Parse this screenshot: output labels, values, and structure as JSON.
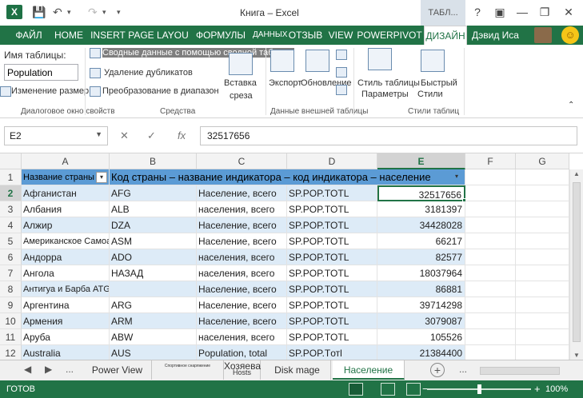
{
  "window": {
    "title": "Книга – Excel",
    "context_tab_header": "ТАБЛ...",
    "help": "?",
    "ribbon_display": "▣",
    "minimize": "—",
    "restore": "❐",
    "close": "✕"
  },
  "quick_access": {
    "save_icon": "save-icon",
    "undo": "↶",
    "redo": "↷",
    "customize": "▾"
  },
  "tabs": [
    {
      "label": "ФАЙЛ"
    },
    {
      "label": "HOME"
    },
    {
      "label": "INSERT"
    },
    {
      "label": "PAGE LAYOU"
    },
    {
      "label": "ФОРМУЛЫ"
    },
    {
      "label": "ДАННЫХ"
    },
    {
      "label": "ОТЗЫВ"
    },
    {
      "label": "VIEW"
    },
    {
      "label": "POWERPIVOT"
    },
    {
      "label": "ДИЗАЙН"
    }
  ],
  "user": {
    "name": "Дэвид Иса",
    "smiley": "☺"
  },
  "ribbon": {
    "table_name_label": "Имя таблицы:",
    "table_name_value": "Population",
    "resize_table": "Изменение размер",
    "summarize_pivot": "Сводные данные с помощью сводной таблицы",
    "remove_duplicates": "Удаление дубликатов",
    "convert_to_range": "Преобразование в диапазон",
    "insert_slicer_line1": "Вставка",
    "insert_slicer_line2": "среза",
    "export": "Экспорт",
    "refresh": "Обновление",
    "style_options_line1": "Стиль таблицы",
    "style_options_line2": "Параметры",
    "quick_styles_line1": "Быстрый",
    "quick_styles_line2": "Стили",
    "group_properties": "Диалоговое окно свойств",
    "group_tools": "Средства",
    "group_external": "Данные внешней таблицы",
    "group_styles": "Стили таблиц"
  },
  "formula_bar": {
    "name_box": "E2",
    "cancel": "✕",
    "enter": "✓",
    "fx": "fx",
    "formula": "32517656"
  },
  "grid": {
    "columns": [
      "A",
      "B",
      "C",
      "D",
      "E",
      "F",
      "G"
    ],
    "selected_column": "E",
    "selected_row": "2",
    "header_row": {
      "row": "1",
      "col_a": "Название страны",
      "merged_text": "Код страны – название индикатора – код индикатора – население",
      "filter_glyph": "▾"
    },
    "rows": [
      {
        "row": "2",
        "a": "Афганистан",
        "b": "AFG",
        "c": "Население, всего",
        "d": "SP.POP.TOTL",
        "e": "32517656"
      },
      {
        "row": "3",
        "a": "Албания",
        "b": "ALB",
        "c": "населения, всего",
        "d": "SP.POP.TOTL",
        "e": "3181397"
      },
      {
        "row": "4",
        "a": "Алжир",
        "b": "DZA",
        "c": "Население, всего",
        "d": "SP.POP.TOTL",
        "e": "34428028"
      },
      {
        "row": "5",
        "a": "Американское Самоа",
        "b": "ASM",
        "c": "Население, всего",
        "d": "SP.POP.TOTL",
        "e": "66217"
      },
      {
        "row": "6",
        "a": "Андорра",
        "b": "ADO",
        "c": "населения, всего",
        "d": "SP.POP.TOTL",
        "e": "82577"
      },
      {
        "row": "7",
        "a": "Ангола",
        "b": "НАЗАД",
        "c": "населения, всего",
        "d": "SP.POP.TOTL",
        "e": "18037964"
      },
      {
        "row": "8",
        "a": "Антигуа и Барба ATG",
        "b": "",
        "c": "Население, всего",
        "d": "SP.POP.TOTL",
        "e": "86881"
      },
      {
        "row": "9",
        "a": "Аргентина",
        "b": "ARG",
        "c": "Население, всего",
        "d": "SP.POP.TOTL",
        "e": "39714298"
      },
      {
        "row": "10",
        "a": "Армения",
        "b": "ARM",
        "c": "Население, всего",
        "d": "SP.POP.TOTL",
        "e": "3079087"
      },
      {
        "row": "11",
        "a": "Аруба",
        "b": "ABW",
        "c": "населения, всего",
        "d": "SP.POP.TOTL",
        "e": "105526"
      },
      {
        "row": "12",
        "a": "Australia",
        "b": "AUS",
        "c": "Population, total",
        "d": "SP.POP.Tотl",
        "e": "21384400"
      }
    ]
  },
  "sheets": {
    "prev": "◀",
    "next": "▶",
    "more_left": "...",
    "tabs": [
      {
        "label": "Power View"
      },
      {
        "label": "Спортивное снаряжение"
      },
      {
        "label": "Хозяева"
      },
      {
        "label": "Hosts"
      },
      {
        "label": "Disk mage"
      },
      {
        "label": "Население"
      }
    ],
    "more_right": "...",
    "add": "+"
  },
  "status": {
    "ready": "ГОТОВ",
    "zoom_minus": "−",
    "zoom_plus": "+",
    "zoom": "100%",
    "zoom_fraction": 0.5
  }
}
